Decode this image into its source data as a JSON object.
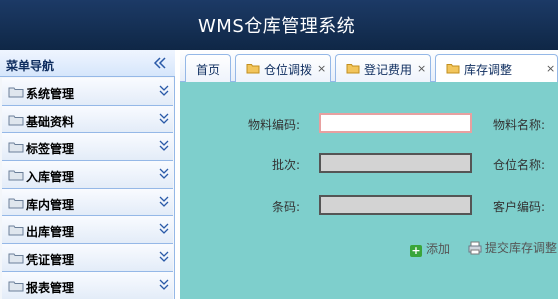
{
  "header": {
    "title": "WMS仓库管理系统"
  },
  "sidebar": {
    "title": "菜单导航",
    "items": [
      {
        "label": "系统管理"
      },
      {
        "label": "基础资料"
      },
      {
        "label": "标签管理"
      },
      {
        "label": "入库管理"
      },
      {
        "label": "库内管理"
      },
      {
        "label": "出库管理"
      },
      {
        "label": "凭证管理"
      },
      {
        "label": "报表管理"
      }
    ]
  },
  "tabs": [
    {
      "label": "首页",
      "closable": false,
      "icon": ""
    },
    {
      "label": "仓位调拨",
      "closable": true,
      "icon": "folder-icon"
    },
    {
      "label": "登记费用",
      "closable": true,
      "icon": "folder-icon"
    },
    {
      "label": "库存调整",
      "closable": true,
      "icon": "folder-icon",
      "active": true
    }
  ],
  "tab_close_glyph": "×",
  "form": {
    "material_code_label": "物料编码:",
    "material_code_value": "",
    "material_name_label": "物料名称:",
    "batch_label": "批次:",
    "batch_value": "",
    "bin_name_label": "仓位名称:",
    "barcode_label": "条码:",
    "barcode_value": "",
    "customer_code_label": "客户编码:"
  },
  "actions": {
    "add_label": "添加",
    "submit_label": "提交库存调整"
  },
  "colors": {
    "header_bg": "#132f55",
    "content_bg": "#7ecfcc",
    "accent_border": "#95b8e7",
    "folder": "#e8b84a"
  }
}
